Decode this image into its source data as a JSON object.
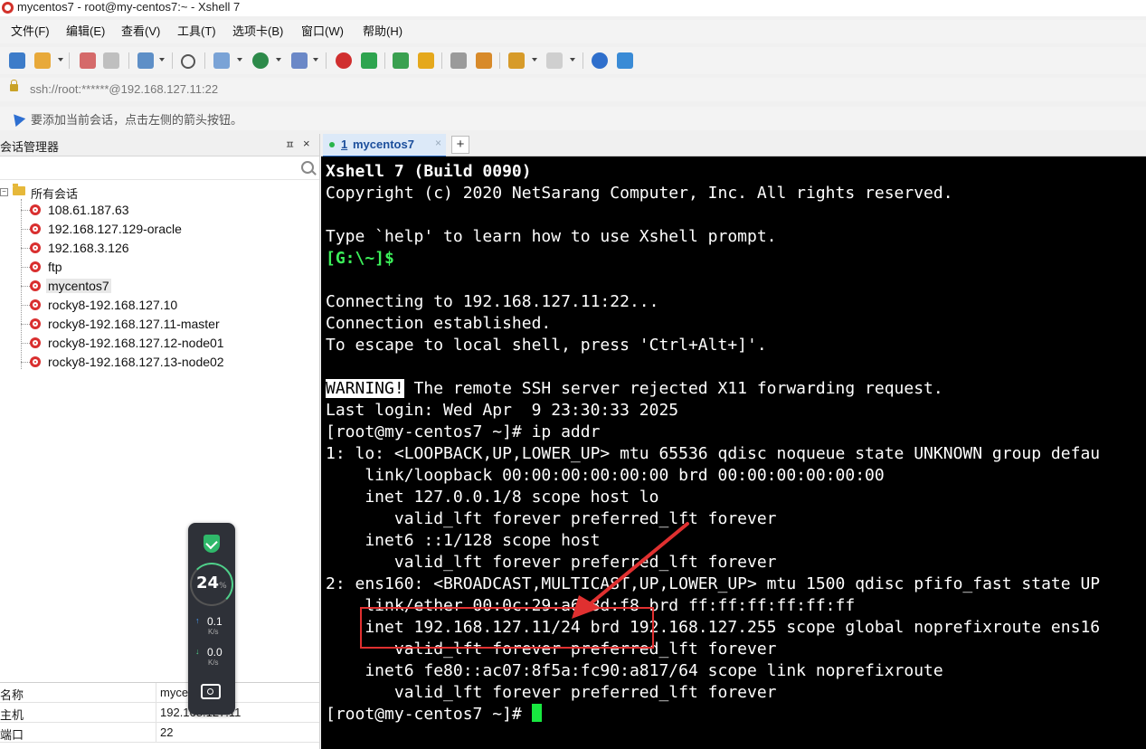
{
  "window": {
    "title": "mycentos7 - root@my-centos7:~ - Xshell 7"
  },
  "menu": [
    "文件(F)",
    "编辑(E)",
    "查看(V)",
    "工具(T)",
    "选项卡(B)",
    "窗口(W)",
    "帮助(H)"
  ],
  "address": {
    "url": "ssh://root:******@192.168.127.11:22"
  },
  "hint": {
    "text": "要添加当前会话，点击左侧的箭头按钮。"
  },
  "session_manager": {
    "title": "会话管理器",
    "pin": "ㅍ",
    "close": "×",
    "root_label": "所有会话",
    "items": [
      "108.61.187.63",
      "192.168.127.129-oracle",
      "192.168.3.126",
      "ftp",
      "mycentos7",
      "rocky8-192.168.127.10",
      "rocky8-192.168.127.11-master",
      "rocky8-192.168.127.12-node01",
      "rocky8-192.168.127.13-node02"
    ],
    "selected": "mycentos7",
    "properties": [
      {
        "key": "名称",
        "value": "mycentos7"
      },
      {
        "key": "主机",
        "value": "192.168.127.11"
      },
      {
        "key": "端口",
        "value": "22"
      }
    ]
  },
  "net_widget": {
    "cpu_percent": "24",
    "percent_symbol": "%",
    "upload": "0.1",
    "download": "0.0",
    "unit": "K/s"
  },
  "tab": {
    "number": "1",
    "name": "mycentos7",
    "close": "×",
    "add": "+"
  },
  "terminal": {
    "lines": [
      {
        "text": "Xshell 7 (Build 0090)",
        "style": "bold"
      },
      {
        "text": "Copyright (c) 2020 NetSarang Computer, Inc. All rights reserved.",
        "style": "normal"
      },
      {
        "text": "",
        "style": "normal"
      },
      {
        "text": "Type `help' to learn how to use Xshell prompt.",
        "style": "normal"
      },
      {
        "text": "[G:\\~]$",
        "style": "green"
      },
      {
        "text": "",
        "style": "normal"
      },
      {
        "text": "Connecting to 192.168.127.11:22...",
        "style": "normal"
      },
      {
        "text": "Connection established.",
        "style": "normal"
      },
      {
        "text": "To escape to local shell, press 'Ctrl+Alt+]'.",
        "style": "normal"
      },
      {
        "text": "",
        "style": "normal"
      },
      {
        "text": " The remote SSH server rejected X11 forwarding request.",
        "style": "warning",
        "prefix": "WARNING!"
      },
      {
        "text": "Last login: Wed Apr  9 23:30:33 2025",
        "style": "normal"
      },
      {
        "text": "[root@my-centos7 ~]# ip addr",
        "style": "normal"
      },
      {
        "text": "1: lo: <LOOPBACK,UP,LOWER_UP> mtu 65536 qdisc noqueue state UNKNOWN group defau",
        "style": "normal"
      },
      {
        "text": "    link/loopback 00:00:00:00:00:00 brd 00:00:00:00:00:00",
        "style": "normal"
      },
      {
        "text": "    inet 127.0.0.1/8 scope host lo",
        "style": "normal"
      },
      {
        "text": "       valid_lft forever preferred_lft forever",
        "style": "normal"
      },
      {
        "text": "    inet6 ::1/128 scope host",
        "style": "normal"
      },
      {
        "text": "       valid_lft forever preferred_lft forever",
        "style": "normal"
      },
      {
        "text": "2: ens160: <BROADCAST,MULTICAST,UP,LOWER_UP> mtu 1500 qdisc pfifo_fast state UP",
        "style": "normal"
      },
      {
        "text": "    link/ether 00:0c:29:a6:8d:f8 brd ff:ff:ff:ff:ff:ff",
        "style": "normal"
      },
      {
        "text": "    inet 192.168.127.11/24 brd 192.168.127.255 scope global noprefixroute ens16",
        "style": "normal"
      },
      {
        "text": "       valid_lft forever preferred_lft forever",
        "style": "normal"
      },
      {
        "text": "    inet6 fe80::ac07:8f5a:fc90:a817/64 scope link noprefixroute",
        "style": "normal"
      },
      {
        "text": "       valid_lft forever preferred_lft forever",
        "style": "normal"
      },
      {
        "text": "[root@my-centos7 ~]# ",
        "style": "prompt"
      }
    ]
  },
  "colors": {
    "accent": "#2b6cc4",
    "terminal_bg": "#000000",
    "highlight_red": "#e03030",
    "cursor": "#18e840"
  }
}
